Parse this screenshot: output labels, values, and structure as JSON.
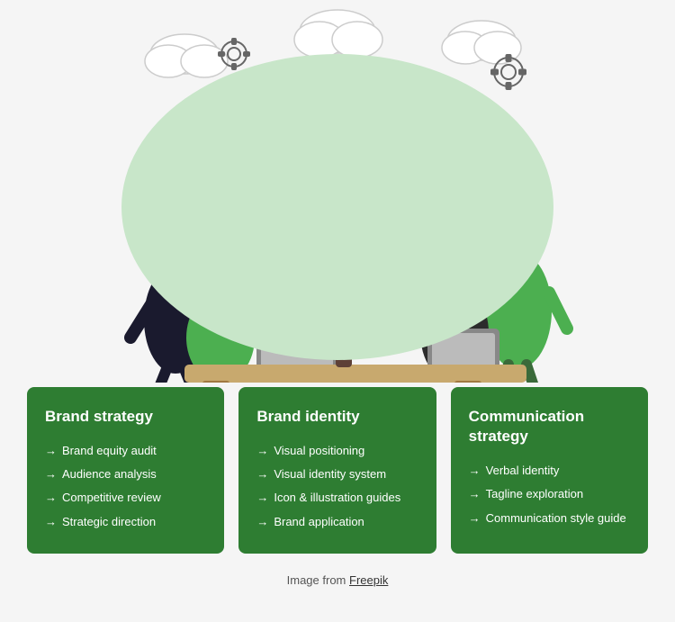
{
  "illustration": {
    "alt": "Team collaboration illustration"
  },
  "cards": [
    {
      "id": "brand-strategy",
      "title": "Brand strategy",
      "items": [
        "Brand equity audit",
        "Audience analysis",
        "Competitive review",
        "Strategic direction"
      ]
    },
    {
      "id": "brand-identity",
      "title": "Brand identity",
      "items": [
        "Visual positioning",
        "Visual identity system",
        "Icon & illustration guides",
        "Brand application"
      ]
    },
    {
      "id": "communication-strategy",
      "title": "Communication strategy",
      "items": [
        "Verbal identity",
        "Tagline exploration",
        "Communication style guide"
      ]
    }
  ],
  "footer": {
    "text": "Image from ",
    "link_label": "Freepik",
    "link_href": "#"
  }
}
